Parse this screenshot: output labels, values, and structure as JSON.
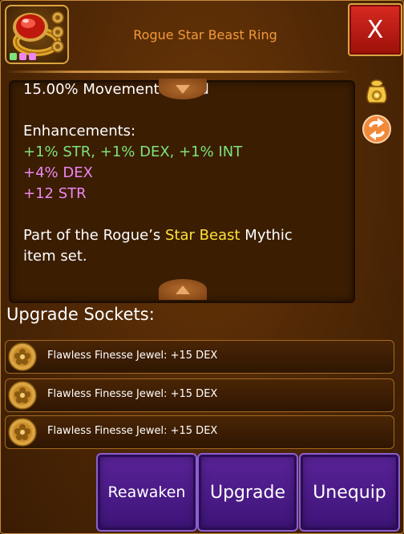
{
  "item": {
    "title": "Rogue Star Beast Ring",
    "icon": "ruby-ring-icon",
    "socket_dot_colors": [
      "#7ee27a",
      "#ee86f0",
      "#ee86f0"
    ]
  },
  "close_button": {
    "label": "X"
  },
  "description": {
    "stat": "15.00% Movement Speed",
    "enhancements_heading": "Enhancements:",
    "enhancement_lines": [
      {
        "text": "+1% STR, +1% DEX, +1% INT",
        "color": "#7ee27a"
      },
      {
        "text": "+4% DEX",
        "color": "#ee86f0"
      },
      {
        "text": "+12 STR",
        "color": "#ee86f0"
      }
    ],
    "set_text_before": "Part of the Rogue’s ",
    "set_name": "Star Beast",
    "set_text_after": " Mythic",
    "set_text_line2": "item set."
  },
  "side_icons": [
    "gold-bag-icon",
    "swap-arrows-icon"
  ],
  "sockets": {
    "heading": "Upgrade Sockets:",
    "items": [
      {
        "label": "Flawless Finesse Jewel: +15 DEX",
        "icon": "finesse-jewel-icon"
      },
      {
        "label": "Flawless Finesse Jewel: +15 DEX",
        "icon": "finesse-jewel-icon"
      },
      {
        "label": "Flawless Finesse Jewel: +15 DEX",
        "icon": "finesse-jewel-icon"
      }
    ]
  },
  "buttons": {
    "reawaken": "Reawaken",
    "upgrade": "Upgrade",
    "unequip": "Unequip"
  },
  "colors": {
    "title": "#f29a3a",
    "highlight_set": "#ffe23a",
    "button_purple": "#5a2398",
    "close_red": "#d92a22"
  }
}
